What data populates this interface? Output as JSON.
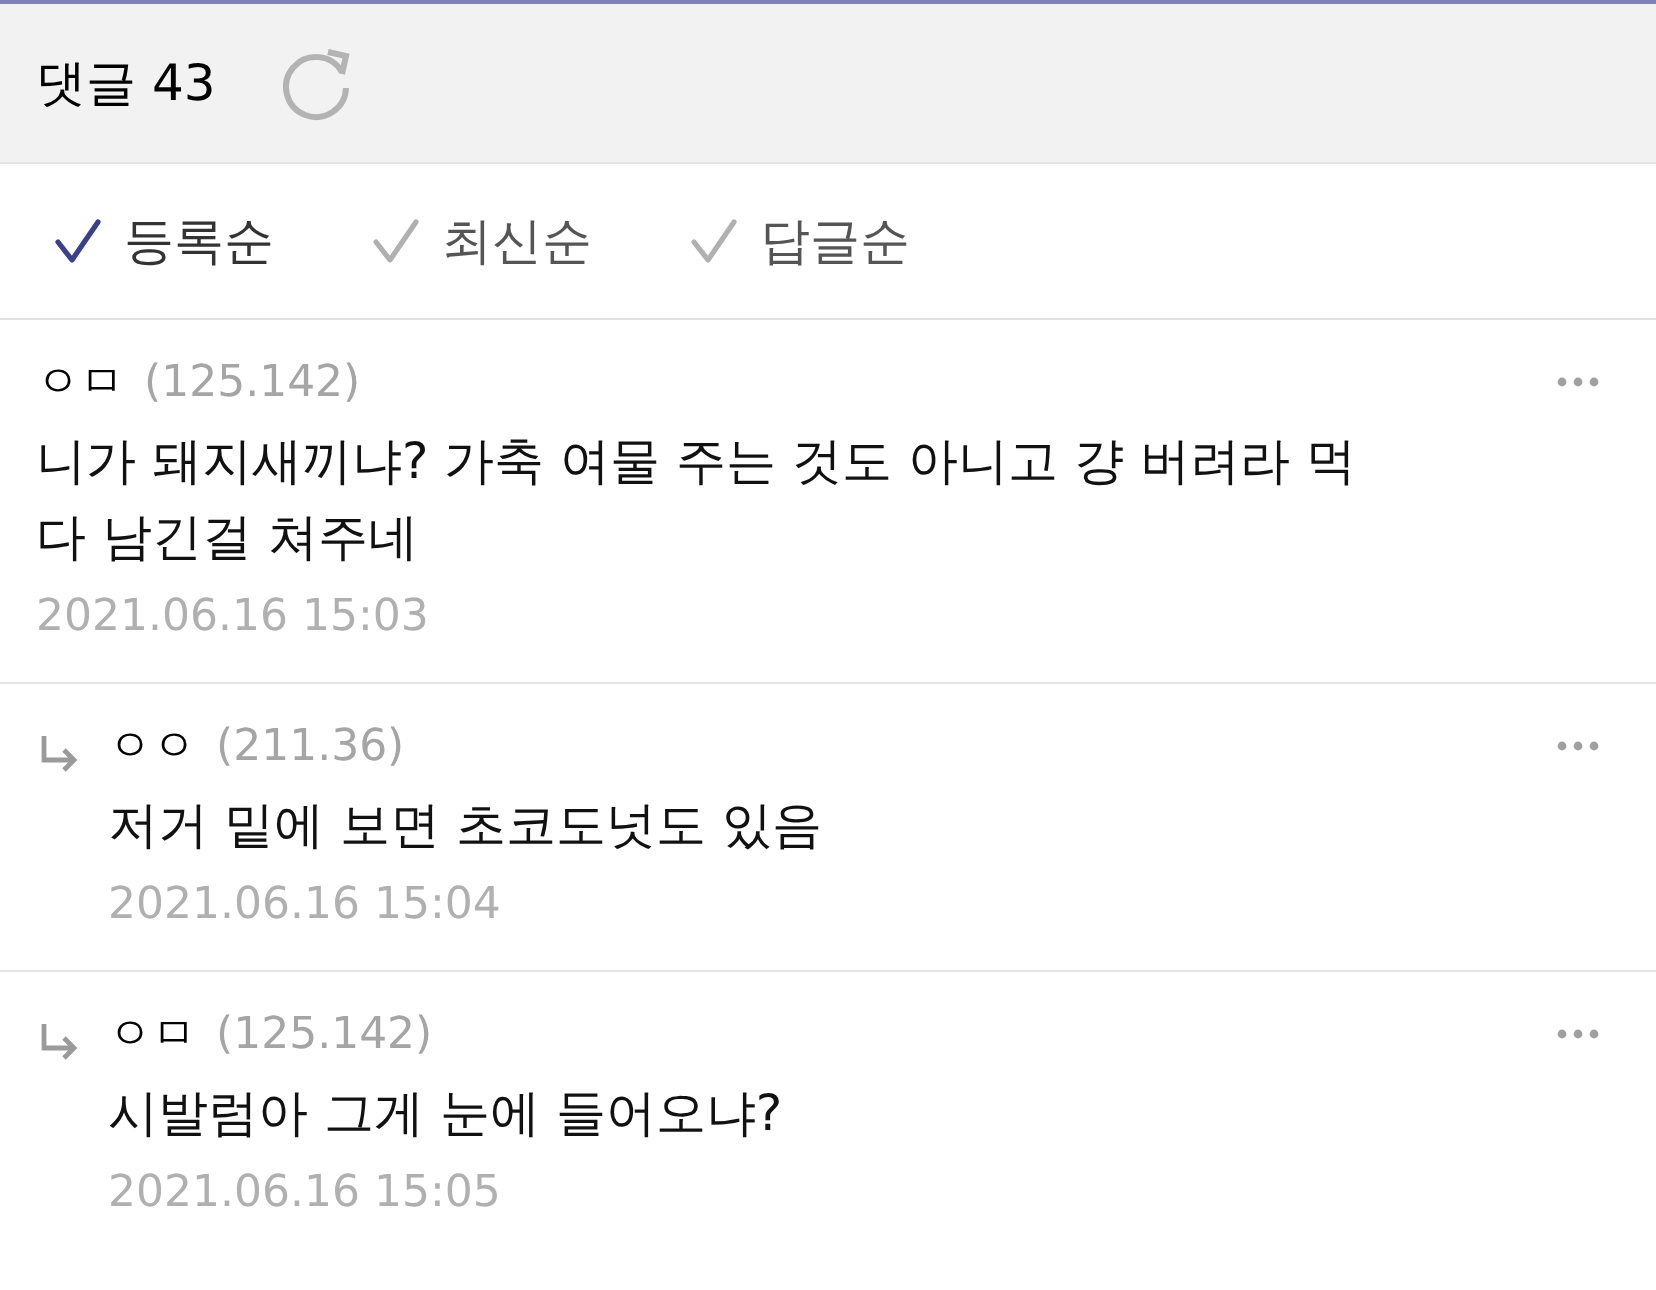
{
  "header": {
    "title": "댓글 43"
  },
  "sort_tabs": [
    {
      "label": "등록순",
      "selected": true
    },
    {
      "label": "최신순",
      "selected": false
    },
    {
      "label": "답글순",
      "selected": false
    }
  ],
  "comments": [
    {
      "kind": "comment",
      "author": "ㅇㅁ",
      "ip": "(125.142)",
      "body": "니가 돼지새끼냐? 가축 여물 주는 것도 아니고 걍 버려라 먹다 남긴걸 쳐주네",
      "date": "2021.06.16 15:03"
    },
    {
      "kind": "reply",
      "author": "ㅇㅇ",
      "ip": "(211.36)",
      "body": "저거 밑에 보면 초코도넛도 있음",
      "date": "2021.06.16 15:04"
    },
    {
      "kind": "reply",
      "author": "ㅇㅁ",
      "ip": "(125.142)",
      "body": "시발럼아 그게 눈에 들어오냐?",
      "date": "2021.06.16 15:05"
    }
  ]
}
